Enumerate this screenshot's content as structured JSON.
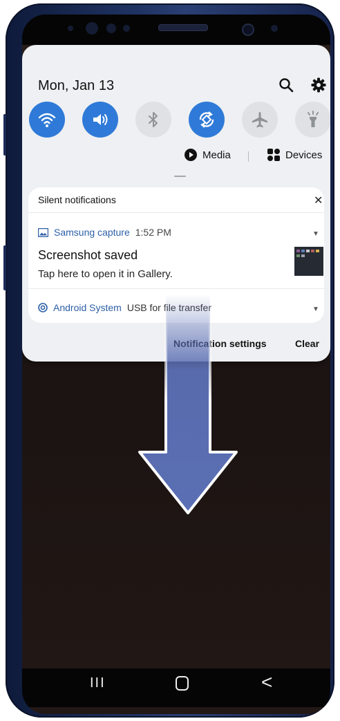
{
  "header": {
    "date": "Mon, Jan 13",
    "search_icon": "search-icon",
    "settings_icon": "gear-icon"
  },
  "quick_settings": {
    "tiles": [
      {
        "name": "wifi",
        "state": "on",
        "icon": "wifi-icon"
      },
      {
        "name": "sound",
        "state": "on",
        "icon": "volume-icon"
      },
      {
        "name": "bluetooth",
        "state": "off",
        "icon": "bluetooth-icon"
      },
      {
        "name": "auto-rotate",
        "state": "on",
        "icon": "rotate-icon"
      },
      {
        "name": "airplane",
        "state": "off",
        "icon": "airplane-icon"
      },
      {
        "name": "flashlight",
        "state": "off",
        "icon": "flashlight-icon"
      }
    ],
    "media_label": "Media",
    "devices_label": "Devices"
  },
  "notifications": {
    "section_title": "Silent notifications",
    "items": [
      {
        "app": "Samsung capture",
        "time": "1:52 PM",
        "title": "Screenshot saved",
        "body": "Tap here to open it in Gallery."
      },
      {
        "app": "Android System",
        "body": "USB for file transfer"
      }
    ],
    "settings_label": "Notification settings",
    "clear_label": "Clear"
  },
  "navbar": {
    "recents": "III",
    "back": "<"
  },
  "colors": {
    "accent": "#2f7ad8",
    "app_name": "#2c5fa8",
    "arrow": "#5b6fb4"
  }
}
